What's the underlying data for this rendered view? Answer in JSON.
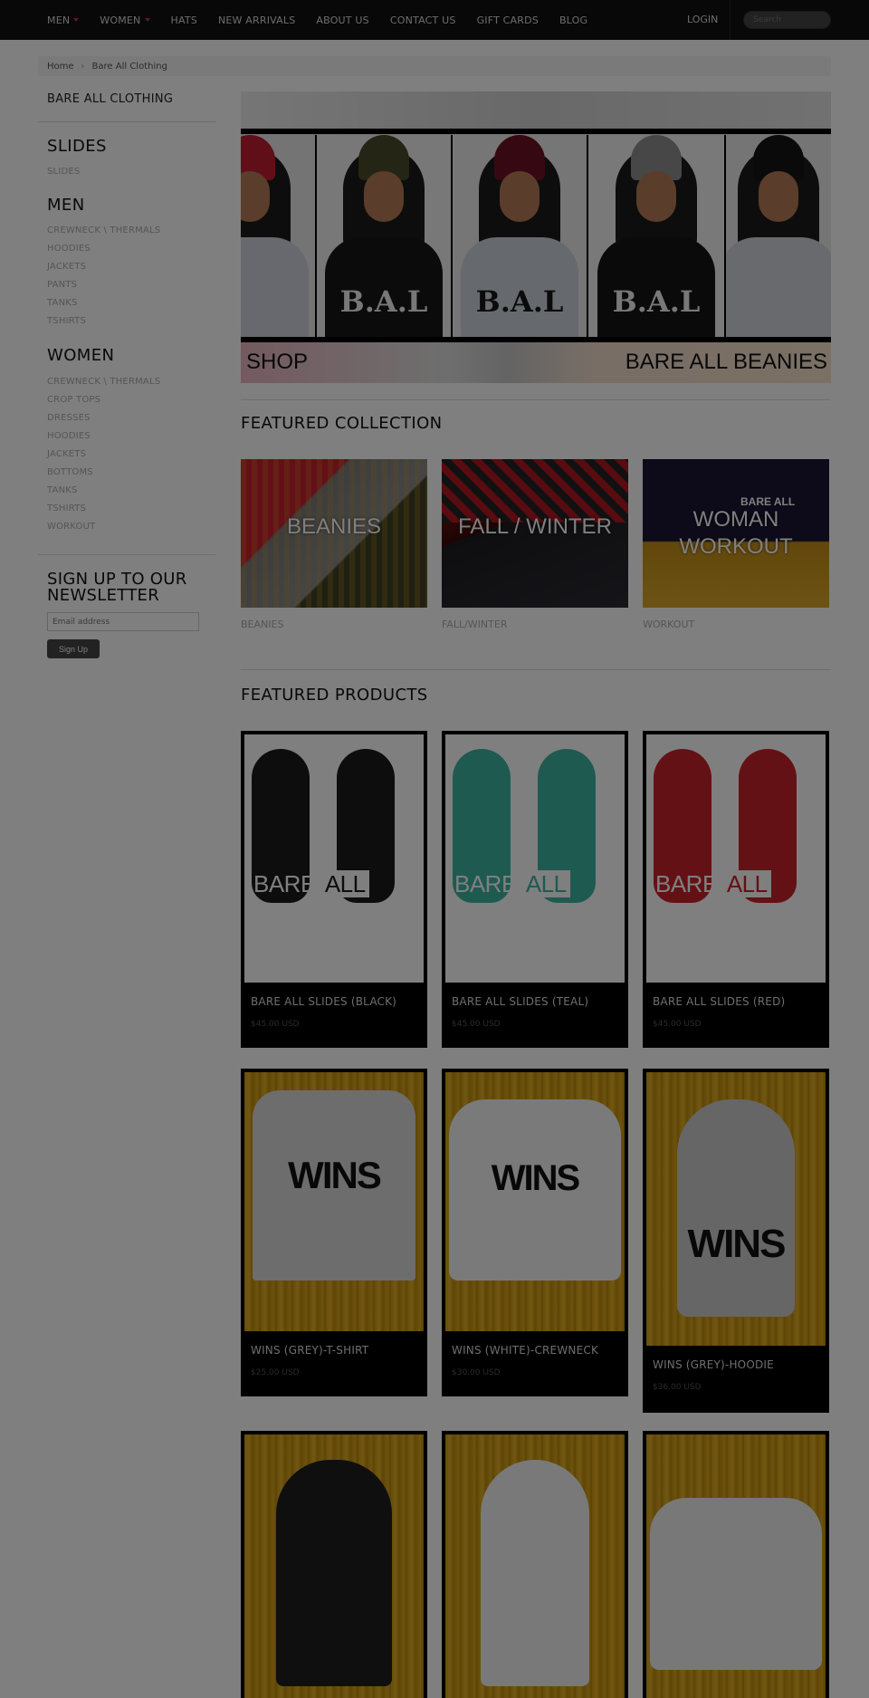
{
  "nav": {
    "items": [
      {
        "label": "MEN",
        "caret": true
      },
      {
        "label": "WOMEN",
        "caret": true
      },
      {
        "label": "HATS",
        "caret": false
      },
      {
        "label": "NEW ARRIVALS",
        "caret": false
      },
      {
        "label": "ABOUT US",
        "caret": false
      },
      {
        "label": "CONTACT US",
        "caret": false
      },
      {
        "label": "GIFT CARDS",
        "caret": false
      },
      {
        "label": "BLOG",
        "caret": false
      }
    ],
    "login": "LOGIN",
    "search_placeholder": "Search"
  },
  "breadcrumb": {
    "home": "Home",
    "sep": "›",
    "current": "Bare All Clothing"
  },
  "sidebar": {
    "title": "BARE ALL CLOTHING",
    "groups": [
      {
        "heading": "SLIDES",
        "links": [
          "SLIDES"
        ]
      },
      {
        "heading": "MEN",
        "links": [
          "CREWNECK \\ THERMALS",
          "HOODIES",
          "JACKETS",
          "PANTS",
          "TANKS",
          "TSHIRTS"
        ]
      },
      {
        "heading": "WOMEN",
        "links": [
          "CREWNECK \\ THERMALS",
          "CROP TOPS",
          "DRESSES",
          "HOODIES",
          "JACKETS",
          "BOTTOMS",
          "TANKS",
          "TSHIRTS",
          "WORKOUT"
        ]
      }
    ],
    "newsletter": {
      "title": "SIGN UP TO OUR NEWSLETTER",
      "placeholder": "Email address",
      "button": "Sign Up"
    }
  },
  "hero": {
    "left": "SHOP",
    "right": "BARE ALL BEANIES",
    "photo_text": "B.A.L"
  },
  "featured_collection": {
    "title": "FEATURED COLLECTION",
    "items": [
      {
        "overlay": "BEANIES",
        "caption": "BEANIES"
      },
      {
        "overlay": "FALL / WINTER",
        "caption": "FALL/WINTER"
      },
      {
        "overlay": "WOMAN WORKOUT",
        "caption": "WORKOUT",
        "brand": "BARE ALL"
      }
    ]
  },
  "featured_products": {
    "title": "FEATURED PRODUCTS",
    "items": [
      {
        "name": "BARE ALL SLIDES (BLACK)",
        "price": "$45.00 USD"
      },
      {
        "name": "BARE ALL SLIDES (TEAL)",
        "price": "$45.00 USD"
      },
      {
        "name": "BARE ALL SLIDES (RED)",
        "price": "$45.00 USD"
      },
      {
        "name": "WINS (GREY)-T-SHIRT",
        "price": "$25.00 USD"
      },
      {
        "name": "WINS (WHITE)-CREWNECK",
        "price": "$30.00 USD"
      },
      {
        "name": "WINS (GREY)-HOODIE",
        "price": "$36.00 USD"
      }
    ],
    "slide_logo": {
      "bare": "BARE",
      "all": "ALL"
    },
    "wins_logo": "WINS"
  },
  "colors": {
    "slide_black": "#1a1a1a",
    "slide_teal": "#3fb4a3",
    "slide_red": "#c8222a",
    "caret": "#cc3333"
  }
}
